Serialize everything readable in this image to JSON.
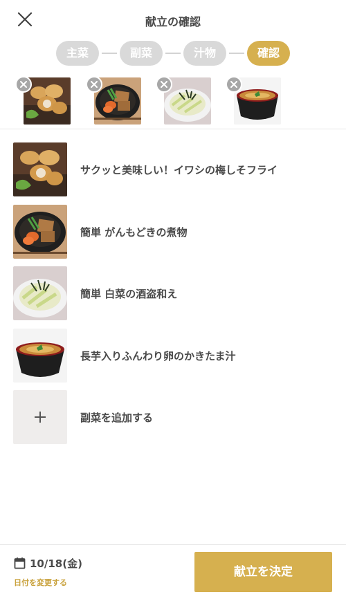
{
  "header": {
    "title": "献立の確認",
    "close_icon": "close-icon"
  },
  "steps": [
    {
      "label": "主菜",
      "active": false
    },
    {
      "label": "副菜",
      "active": false
    },
    {
      "label": "汁物",
      "active": false
    },
    {
      "label": "確認",
      "active": true
    }
  ],
  "selected_thumbnails": [
    {
      "dish": "sardine-fry",
      "remove_icon": "remove-icon"
    },
    {
      "dish": "ganmodoki-stew",
      "remove_icon": "remove-icon"
    },
    {
      "dish": "napa-cabbage",
      "remove_icon": "remove-icon"
    },
    {
      "dish": "egg-soup",
      "remove_icon": "remove-icon"
    }
  ],
  "menu_items": [
    {
      "label": "サクッと美味しい！イワシの梅しそフライ"
    },
    {
      "label": "簡単 がんもどきの煮物"
    },
    {
      "label": "簡単 白菜の酒盗和え"
    },
    {
      "label": "長芋入りふんわり卵のかきたま汁"
    }
  ],
  "add_item": {
    "label": "副菜を追加する",
    "icon": "plus-icon"
  },
  "footer": {
    "date": "10/18(金)",
    "change_date": "日付を変更する",
    "decide": "献立を決定",
    "calendar_icon": "calendar-icon"
  },
  "colors": {
    "accent": "#d6b04f",
    "step_inactive": "#d9d9d9",
    "text": "#4a4a4a",
    "link": "#c9a23d"
  }
}
